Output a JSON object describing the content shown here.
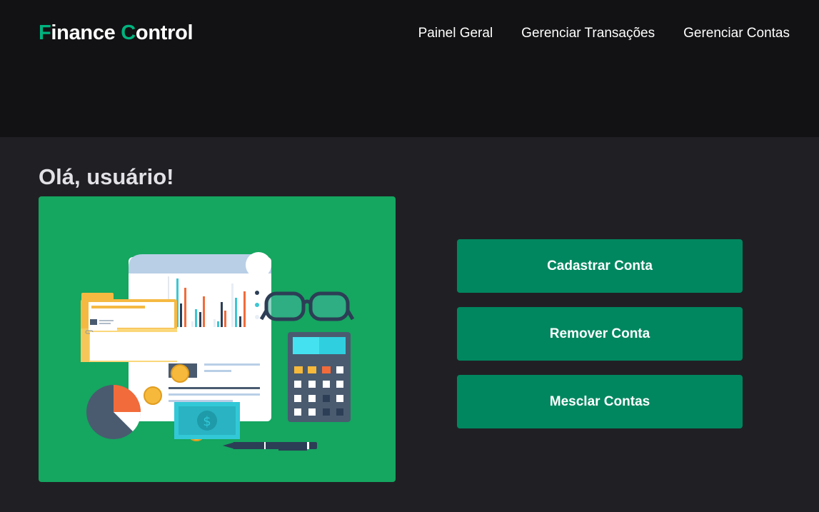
{
  "brand": {
    "first_initial": "F",
    "first_rest": "inance ",
    "second_initial": "C",
    "second_rest": "ontrol",
    "accent_color": "#00b37e"
  },
  "nav": {
    "items": [
      {
        "label": "Painel Geral"
      },
      {
        "label": "Gerenciar Transações"
      },
      {
        "label": "Gerenciar Contas"
      }
    ]
  },
  "main": {
    "greeting": "Olá, usuário!",
    "illustration": {
      "icon": "finance-illustration",
      "background_color": "#15a660"
    },
    "actions": [
      {
        "label": "Cadastrar Conta"
      },
      {
        "label": "Remover Conta"
      },
      {
        "label": "Mesclar Contas"
      }
    ],
    "button_color": "#00875f"
  }
}
